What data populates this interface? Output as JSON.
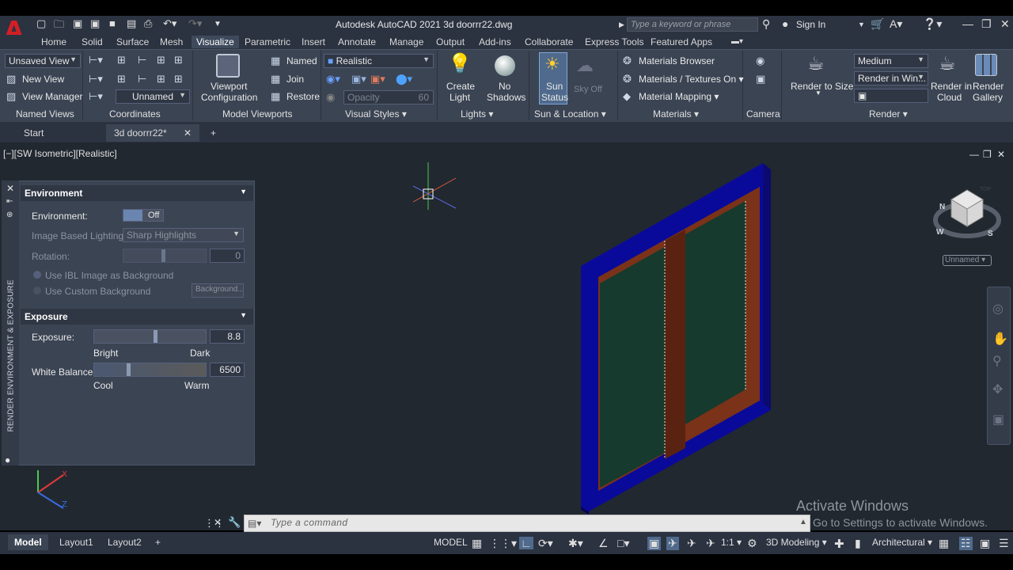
{
  "window": {
    "title": "Autodesk AutoCAD 2021   3d doorrr22.dwg",
    "search_placeholder": "Type a keyword or phrase",
    "sign_in": "Sign In"
  },
  "ribbon_tabs": [
    "Home",
    "Solid",
    "Surface",
    "Mesh",
    "Visualize",
    "Parametric",
    "Insert",
    "Annotate",
    "Manage",
    "Output",
    "Add-ins",
    "Collaborate",
    "Express Tools",
    "Featured Apps"
  ],
  "active_tab": "Visualize",
  "ribbon": {
    "named_views": {
      "combo": "Unsaved View",
      "new_view": "New View",
      "view_manager": "View Manager",
      "label": "Named Views"
    },
    "coordinates": {
      "combo": "Unnamed",
      "label": "Coordinates"
    },
    "model_viewports": {
      "viewport_config_1": "Viewport",
      "viewport_config_2": "Configuration",
      "named": "Named",
      "join": "Join",
      "restore": "Restore",
      "label": "Model Viewports"
    },
    "visual_styles": {
      "combo": "Realistic",
      "opacity_label": "Opacity",
      "opacity_value": "60",
      "label": "Visual Styles"
    },
    "lights": {
      "create_light_1": "Create",
      "create_light_2": "Light",
      "no_shadows_1": "No",
      "no_shadows_2": "Shadows",
      "label": "Lights"
    },
    "sun_location": {
      "sun_status_1": "Sun",
      "sun_status_2": "Status",
      "sky_off_1": "Sky Off",
      "label": "Sun & Location"
    },
    "materials": {
      "browser": "Materials Browser",
      "textures": "Materials / Textures On",
      "mapping": "Material Mapping",
      "label": "Materials"
    },
    "camera": {
      "label": "Camera"
    },
    "render": {
      "render_to_size_1": "Render to Size",
      "quality": "Medium",
      "render_in": "Render in Win...",
      "cloud_1": "Render in",
      "cloud_2": "Cloud",
      "gallery_1": "Render",
      "gallery_2": "Gallery",
      "label": "Render"
    }
  },
  "doc_tabs": [
    "Start",
    "3d doorrr22*"
  ],
  "viewport_label": "[−][SW Isometric][Realistic]",
  "viewcube": {
    "top": "TOP",
    "north": "N",
    "west": "W",
    "south": "S",
    "ucs": "Unnamed"
  },
  "palette": {
    "side_title": "RENDER ENVIRONMENT & EXPOSURE",
    "environment_header": "Environment",
    "environment_label": "Environment:",
    "environment_toggle": "Off",
    "ibl_label": "Image Based Lighting:",
    "ibl_value": "Sharp Highlights",
    "rotation_label": "Rotation:",
    "rotation_value": "0",
    "use_ibl_bg": "Use IBL Image as Background",
    "use_custom_bg": "Use Custom Background",
    "background_button": "Background...",
    "exposure_header": "Exposure",
    "exposure_label": "Exposure:",
    "exposure_value": "8.8",
    "exposure_level": 0.55,
    "bright": "Bright",
    "dark": "Dark",
    "wb_label": "White Balance:",
    "wb_value": "6500",
    "wb_level": 0.3,
    "cool": "Cool",
    "warm": "Warm"
  },
  "command_line": {
    "placeholder": "Type a command"
  },
  "layout_tabs": [
    "Model",
    "Layout1",
    "Layout2"
  ],
  "status": {
    "model": "MODEL",
    "scale": "1:1",
    "workspace": "3D Modeling",
    "units": "Architectural"
  },
  "watermark": {
    "line1": "Activate Windows",
    "line2": "Go to Settings to activate Windows."
  }
}
